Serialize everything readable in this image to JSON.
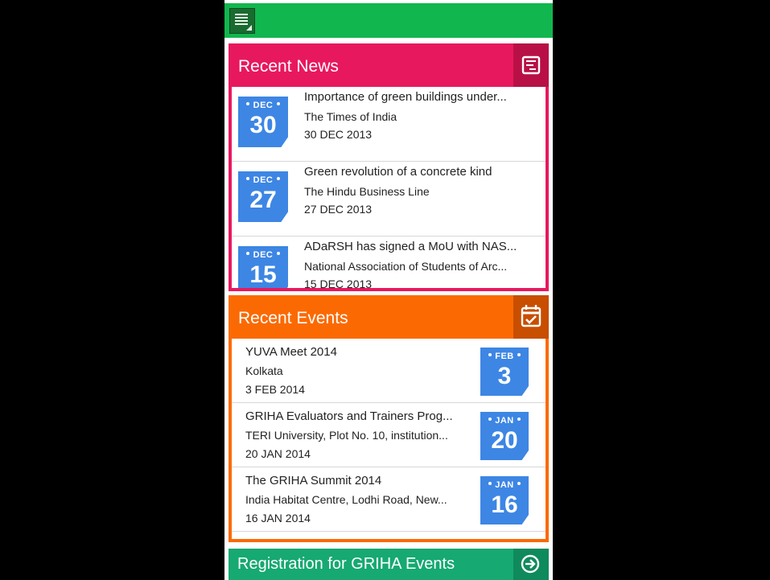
{
  "topbar": {
    "menu_icon": "menu-icon"
  },
  "news": {
    "title": "Recent News",
    "icon": "news-list-icon",
    "items": [
      {
        "month": "DEC",
        "day": "30",
        "title": "Importance of green buildings under...",
        "source": "The Times of India",
        "date": "30 DEC 2013"
      },
      {
        "month": "DEC",
        "day": "27",
        "title": "Green revolution of a concrete kind",
        "source": "The Hindu Business Line",
        "date": "27 DEC 2013"
      },
      {
        "month": "DEC",
        "day": "15",
        "title": "ADaRSH has signed a MoU with NAS...",
        "source": "National Association of Students of Arc...",
        "date": "15 DEC 2013"
      }
    ]
  },
  "events": {
    "title": "Recent Events",
    "icon": "calendar-check-icon",
    "items": [
      {
        "title": "YUVA Meet 2014",
        "location": "Kolkata",
        "date": "3 FEB 2014",
        "month": "FEB",
        "day": "3"
      },
      {
        "title": "GRIHA Evaluators and Trainers Prog...",
        "location": "TERI University, Plot No. 10, institution...",
        "date": "20 JAN 2014",
        "month": "JAN",
        "day": "20"
      },
      {
        "title": "The GRIHA Summit 2014",
        "location": "India Habitat Centre, Lodhi Road, New...",
        "date": "16 JAN 2014",
        "month": "JAN",
        "day": "16"
      }
    ]
  },
  "registration": {
    "label": "Registration for GRIHA Events",
    "icon": "arrow-right-circle-icon"
  },
  "colors": {
    "topbar": "#11b64e",
    "news": "#e8185e",
    "events": "#fb6a02",
    "registration": "#16a972",
    "calendar": "#3d86e4"
  }
}
